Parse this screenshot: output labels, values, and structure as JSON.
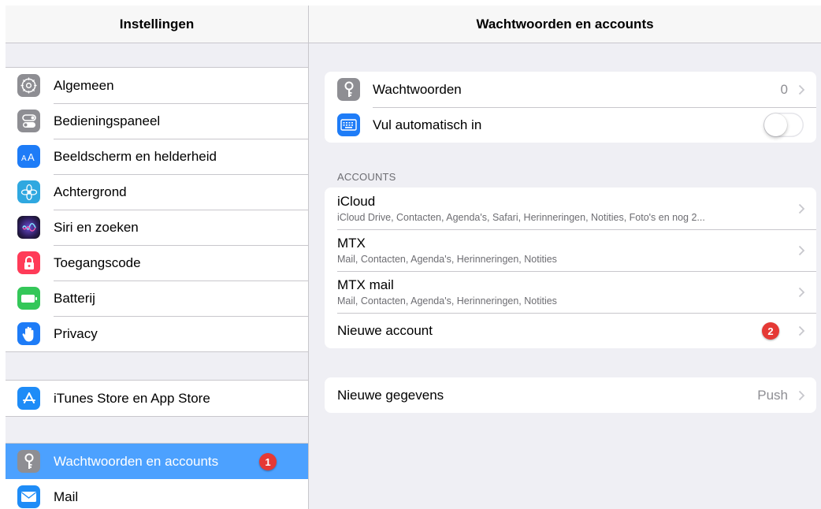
{
  "sidebar": {
    "title": "Instellingen",
    "group1": [
      {
        "label": "Algemeen",
        "icon": "gear-icon"
      },
      {
        "label": "Bedieningspaneel",
        "icon": "control-center-icon"
      },
      {
        "label": "Beeldscherm en helderheid",
        "icon": "display-brightness-icon"
      },
      {
        "label": "Achtergrond",
        "icon": "wallpaper-icon"
      },
      {
        "label": "Siri en zoeken",
        "icon": "siri-icon"
      },
      {
        "label": "Toegangscode",
        "icon": "lock-icon"
      },
      {
        "label": "Batterij",
        "icon": "battery-icon"
      },
      {
        "label": "Privacy",
        "icon": "hand-icon"
      }
    ],
    "group2": [
      {
        "label": "iTunes Store en App Store",
        "icon": "app-store-icon"
      }
    ],
    "group3": [
      {
        "label": "Wachtwoorden en accounts",
        "icon": "key-icon",
        "selected": true,
        "badge": "1"
      },
      {
        "label": "Mail",
        "icon": "mail-icon"
      }
    ]
  },
  "detail": {
    "title": "Wachtwoorden en accounts",
    "passwords": {
      "label": "Wachtwoorden",
      "value": "0",
      "icon": "key-icon"
    },
    "autofill": {
      "label": "Vul automatisch in",
      "icon": "keyboard-icon",
      "toggle_on": false
    },
    "accounts_header": "ACCOUNTS",
    "accounts": [
      {
        "title": "iCloud",
        "subtitle": "iCloud Drive, Contacten, Agenda's, Safari, Herinneringen, Notities, Foto's en nog 2..."
      },
      {
        "title": "MTX",
        "subtitle": "Mail, Contacten, Agenda's, Herinneringen, Notities"
      },
      {
        "title": "MTX mail",
        "subtitle": "Mail, Contacten, Agenda's, Herinneringen, Notities"
      }
    ],
    "new_account": {
      "label": "Nieuwe account",
      "badge": "2"
    },
    "fetch": {
      "label": "Nieuwe gegevens",
      "value": "Push"
    }
  },
  "colors": {
    "selected": "#4ca1ff",
    "badge": "#e53935",
    "gray_icon": "#8e8e93",
    "blue_icon": "#1e7cf7",
    "red_icon": "#ff3b58",
    "green_icon": "#34c759",
    "background": "#efeff4"
  }
}
